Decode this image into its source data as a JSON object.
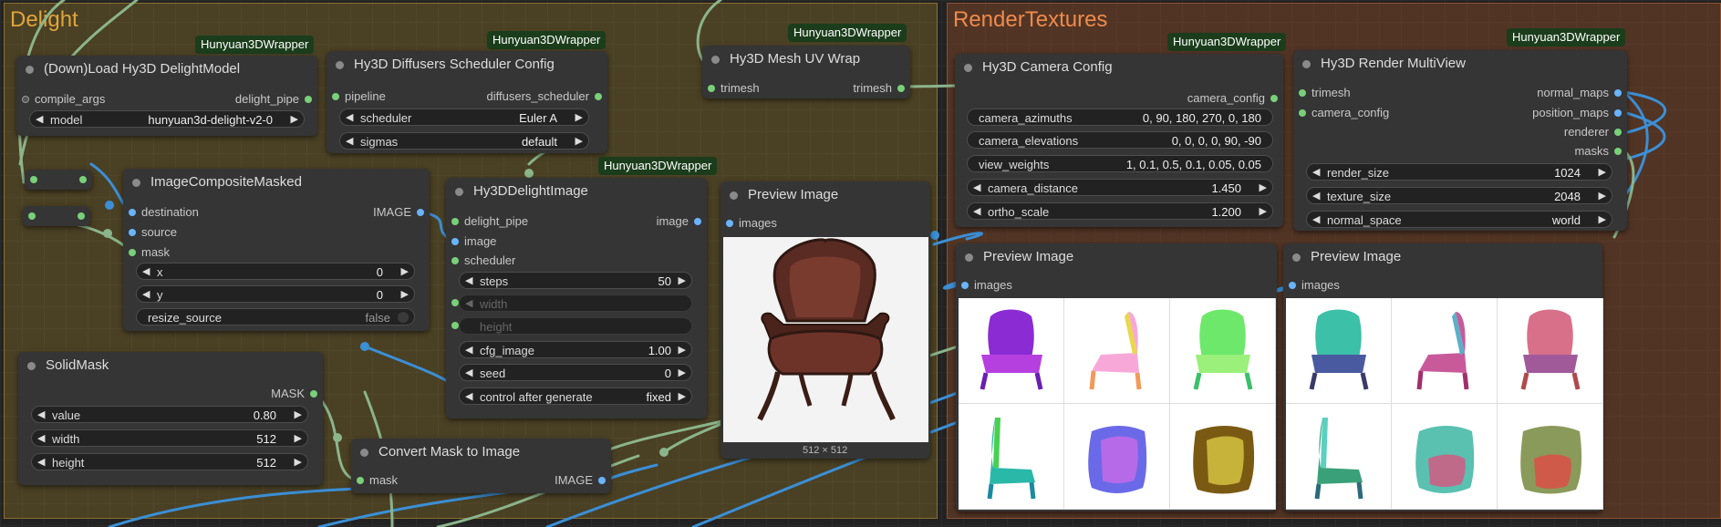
{
  "groups": {
    "delight": {
      "title": "Delight",
      "color": "#e0a63a"
    },
    "render": {
      "title": "RenderTextures",
      "color": "#f08a4b"
    }
  },
  "colors": {
    "wire_blue": "#3b8fd6",
    "wire_green": "#8bb58b",
    "slot_blue": "#6ab4ff",
    "slot_green": "#79d079",
    "badge_bg": "#1b3d1b"
  },
  "nodes": {
    "load_delight": {
      "badge": "Hunyuan3DWrapper",
      "title": "(Down)Load Hy3D DelightModel",
      "inputs": [
        "compile_args"
      ],
      "outputs": [
        "delight_pipe"
      ],
      "model_label": "model",
      "model_value": "hunyuan3d-delight-v2-0"
    },
    "scheduler": {
      "badge": "Hunyuan3DWrapper",
      "title": "Hy3D Diffusers Scheduler Config",
      "inputs": [
        "pipeline"
      ],
      "outputs": [
        "diffusers_scheduler"
      ],
      "widgets": [
        {
          "label": "scheduler",
          "value": "Euler A"
        },
        {
          "label": "sigmas",
          "value": "default"
        }
      ]
    },
    "uvwrap": {
      "badge": "Hunyuan3DWrapper",
      "title": "Hy3D Mesh UV Wrap",
      "inputs": [
        "trimesh"
      ],
      "outputs": [
        "trimesh"
      ]
    },
    "composite": {
      "title": "ImageCompositeMasked",
      "inputs": [
        "destination",
        "source",
        "mask"
      ],
      "outputs": [
        "IMAGE"
      ],
      "widgets": [
        {
          "label": "x",
          "value": "0"
        },
        {
          "label": "y",
          "value": "0"
        },
        {
          "label": "resize_source",
          "value": "false"
        }
      ]
    },
    "delight_image": {
      "badge": "Hunyuan3DWrapper",
      "title": "Hy3DDelightImage",
      "inputs": [
        "delight_pipe",
        "image",
        "scheduler"
      ],
      "outputs": [
        "image"
      ],
      "widgets": [
        {
          "label": "steps",
          "value": "50"
        },
        {
          "label": "width",
          "value": ""
        },
        {
          "label": "height",
          "value": ""
        },
        {
          "label": "cfg_image",
          "value": "1.00"
        },
        {
          "label": "seed",
          "value": "0"
        },
        {
          "label": "control after generate",
          "value": "fixed"
        }
      ]
    },
    "preview1": {
      "title": "Preview Image",
      "inputs": [
        "images"
      ],
      "caption": "512 × 512"
    },
    "solidmask": {
      "title": "SolidMask",
      "outputs": [
        "MASK"
      ],
      "widgets": [
        {
          "label": "value",
          "value": "0.80"
        },
        {
          "label": "width",
          "value": "512"
        },
        {
          "label": "height",
          "value": "512"
        }
      ]
    },
    "convert": {
      "title": "Convert Mask to Image",
      "inputs": [
        "mask"
      ],
      "outputs": [
        "IMAGE"
      ]
    },
    "camera": {
      "badge": "Hunyuan3DWrapper",
      "title": "Hy3D Camera Config",
      "outputs": [
        "camera_config"
      ],
      "widgets": [
        {
          "label": "camera_azimuths",
          "value": "0, 90, 180, 270, 0, 180"
        },
        {
          "label": "camera_elevations",
          "value": "0, 0, 0, 0, 90, -90"
        },
        {
          "label": "view_weights",
          "value": "1, 0.1, 0.5, 0.1, 0.05, 0.05"
        },
        {
          "label": "camera_distance",
          "value": "1.450"
        },
        {
          "label": "ortho_scale",
          "value": "1.200"
        }
      ]
    },
    "multiview": {
      "badge": "Hunyuan3DWrapper",
      "title": "Hy3D Render MultiView",
      "inputs": [
        "trimesh",
        "camera_config"
      ],
      "outputs": [
        "normal_maps",
        "position_maps",
        "renderer",
        "masks"
      ],
      "widgets": [
        {
          "label": "render_size",
          "value": "1024"
        },
        {
          "label": "texture_size",
          "value": "2048"
        },
        {
          "label": "normal_space",
          "value": "world"
        }
      ]
    },
    "preview2": {
      "title": "Preview Image",
      "inputs": [
        "images"
      ]
    },
    "preview3": {
      "title": "Preview Image",
      "inputs": [
        "images"
      ]
    }
  }
}
